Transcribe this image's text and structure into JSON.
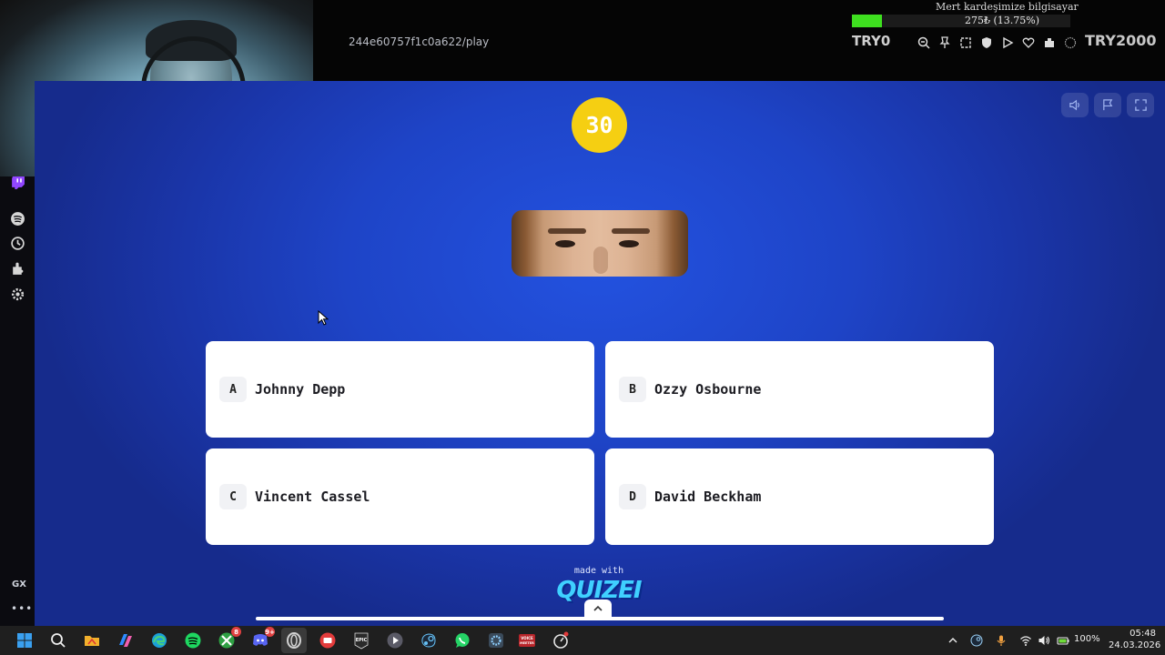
{
  "browser": {
    "url": "244e60757f1c0a622/play",
    "sidebar_label": "GX",
    "sidebar_icons": [
      "twitch-icon",
      "spotify-icon",
      "history-icon",
      "extensions-icon",
      "settings-icon"
    ]
  },
  "stream_overlay": {
    "title": "Mert kardeşimize bilgisayar",
    "amount": "275₺ (13.75%)",
    "progress": 0.1375,
    "left_label": "TRY0",
    "right_label": "TRY2000",
    "progress_color": "#3ee01f"
  },
  "quiz": {
    "timer": "30",
    "answers": [
      {
        "letter": "A",
        "text": "Johnny Depp"
      },
      {
        "letter": "B",
        "text": "Ozzy Osbourne"
      },
      {
        "letter": "C",
        "text": "Vincent Cassel"
      },
      {
        "letter": "D",
        "text": "David Beckham"
      }
    ],
    "made_with": "made with",
    "brand": "QUIZEI",
    "accent_color": "#f5cf12",
    "background_color": "#1e44c7"
  },
  "taskbar": {
    "apps": [
      "windows-start",
      "search",
      "file-explorer",
      "copilot",
      "edge",
      "spotify",
      "xbox",
      "discord",
      "opera-gx",
      "video-recorder",
      "epic-games",
      "media-player",
      "steam",
      "whatsapp",
      "settings-app",
      "voicemeeter",
      "timer-app"
    ],
    "xbox_badge": "8",
    "discord_badge": "9+",
    "battery": "100%",
    "time": "05:48",
    "date": "24.03.2026"
  }
}
